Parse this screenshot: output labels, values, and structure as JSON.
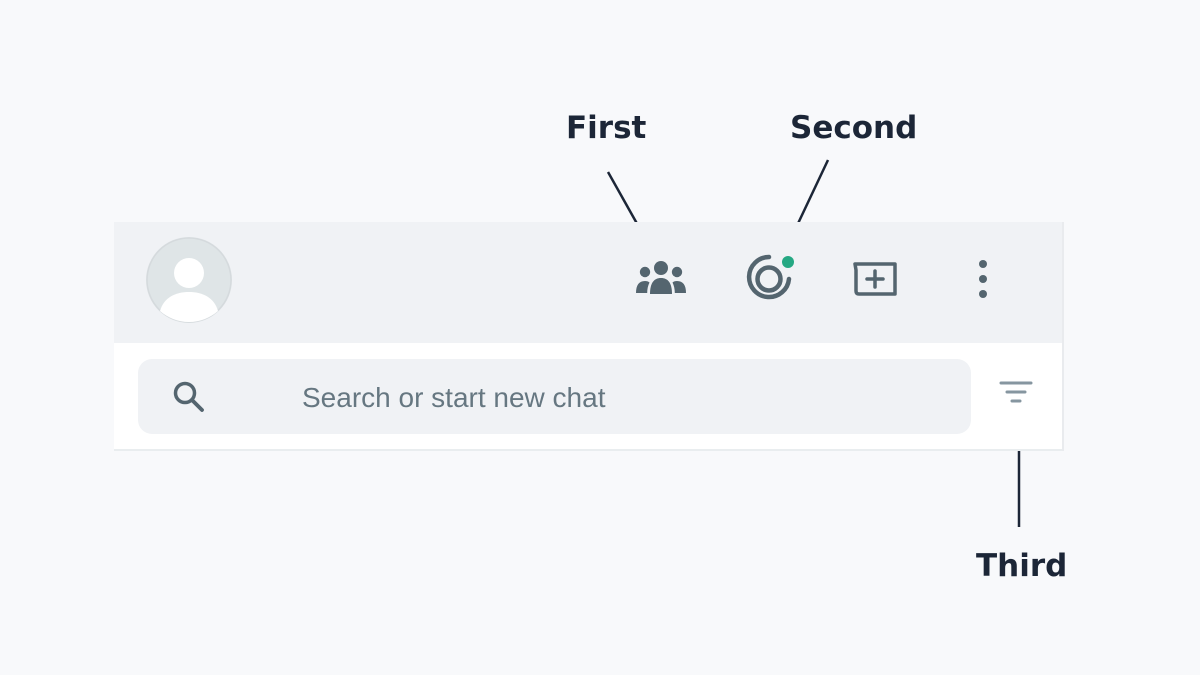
{
  "annotations": {
    "first": "First",
    "second": "Second",
    "third": "Third"
  },
  "header": {
    "avatar_icon": "default-user-avatar",
    "icons": [
      "communities-icon",
      "status-icon",
      "new-chat-icon",
      "menu-kebab-icon"
    ],
    "status_dot_color": "#25a883"
  },
  "search": {
    "placeholder": "Search or start new chat",
    "icon": "search-icon",
    "filter_icon": "filter-icon"
  },
  "colors": {
    "icon": "#54656f",
    "header_bg": "#f0f2f5",
    "annotation_text": "#1c2637"
  }
}
